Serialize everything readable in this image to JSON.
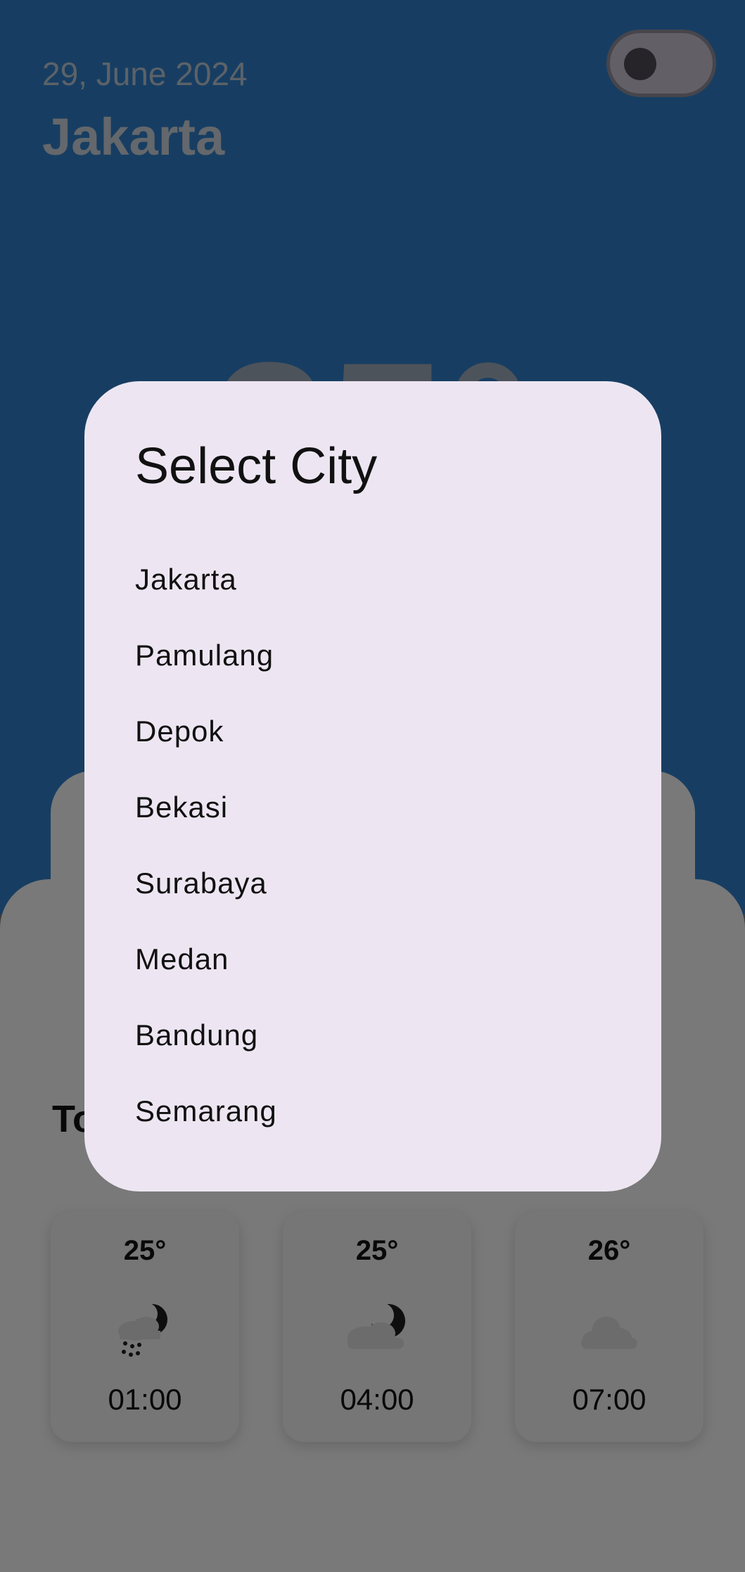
{
  "header": {
    "date": "29, June 2024",
    "city": "Jakarta",
    "current_temp": "25°",
    "theme_toggle": "off"
  },
  "today": {
    "label": "Today",
    "hours": [
      {
        "temp": "25°",
        "icon": "night-rain-icon",
        "time": "01:00"
      },
      {
        "temp": "25°",
        "icon": "night-cloud-icon",
        "time": "04:00"
      },
      {
        "temp": "26°",
        "icon": "cloud-icon",
        "time": "07:00"
      }
    ]
  },
  "dialog": {
    "title": "Select City",
    "cities": [
      "Jakarta",
      "Pamulang",
      "Depok",
      "Bekasi",
      "Surabaya",
      "Medan",
      "Bandung",
      "Semarang"
    ]
  },
  "colors": {
    "header_background": "#2e7cc4",
    "dialog_background": "#ede6f2",
    "scrim": "rgba(0,0,0,0.5)"
  }
}
